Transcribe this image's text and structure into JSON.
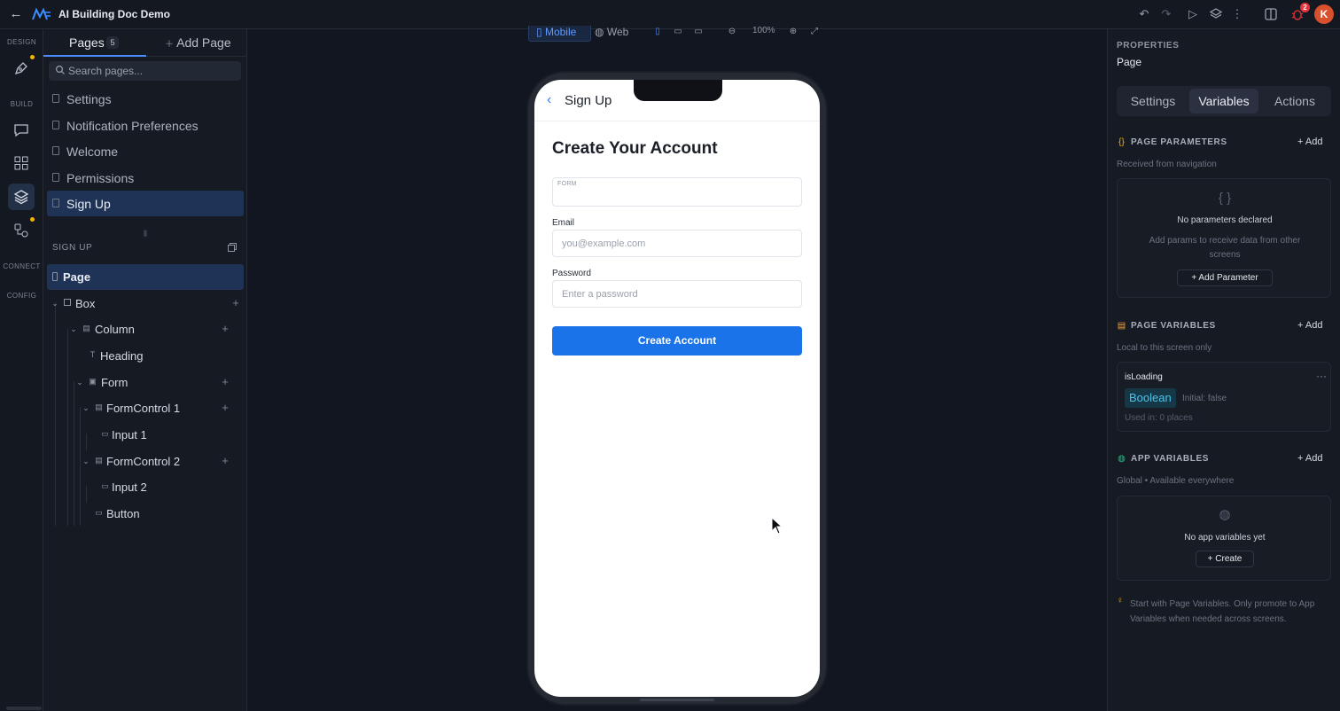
{
  "app": {
    "title": "AI Building Doc Demo",
    "notification_count": "2",
    "avatar_initial": "K"
  },
  "rail": {
    "design": "DESIGN",
    "build": "BUILD",
    "connect": "CONNECT",
    "config": "CONFIG"
  },
  "left": {
    "tab_pages": "Pages",
    "page_count": "5",
    "tab_add": "Add Page",
    "search_placeholder": "Search pages...",
    "pages": [
      "Settings",
      "Notification Preferences",
      "Welcome",
      "Permissions",
      "Sign Up"
    ],
    "tree_title": "SIGN UP",
    "tree": [
      "Page",
      "Box",
      "Column",
      "Heading",
      "Form",
      "FormControl 1",
      "Input 1",
      "FormControl 2",
      "Input 2",
      "Button"
    ]
  },
  "canvas": {
    "mobile_label": "Mobile",
    "web_label": "Web",
    "zoom": "100%"
  },
  "screen": {
    "nav_title": "Sign Up",
    "heading": "Create Your Account",
    "form_label": "FORM",
    "email_label": "Email",
    "email_placeholder": "you@example.com",
    "password_label": "Password",
    "password_placeholder": "Enter a password",
    "button_label": "Create Account"
  },
  "right": {
    "caption": "PROPERTIES",
    "subject": "Page",
    "tabs": [
      "Settings",
      "Variables",
      "Actions"
    ],
    "params": {
      "title": "PAGE PARAMETERS",
      "add": "Add",
      "sub": "Received from navigation",
      "icon_text": "{ }",
      "empty_title": "No parameters declared",
      "empty_desc": "Add params to receive data from other screens",
      "button": "Add Parameter"
    },
    "page_vars": {
      "title": "PAGE VARIABLES",
      "add": "Add",
      "sub": "Local to this screen only",
      "var_name": "isLoading",
      "var_type": "Boolean",
      "var_initial": "Initial: false",
      "var_used": "Used in: 0 places"
    },
    "app_vars": {
      "title": "APP VARIABLES",
      "add": "Add",
      "sub": "Global • Available everywhere",
      "empty_title": "No app variables yet",
      "button": "Create"
    },
    "tip": "Start with Page Variables. Only promote to App Variables when needed across screens."
  },
  "colors": {
    "accent": "#1a73e8",
    "selection": "#1e3355",
    "badge": "#e5333b",
    "boolean": "#4cc4e8"
  }
}
